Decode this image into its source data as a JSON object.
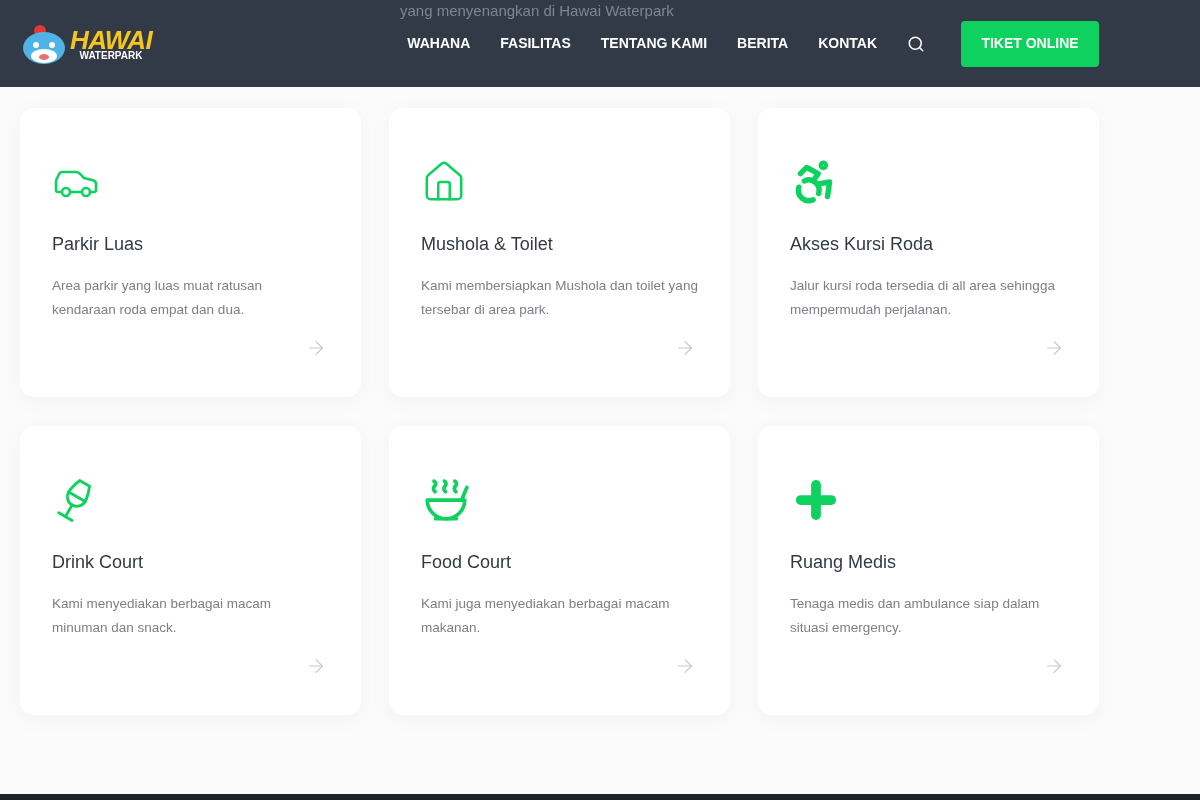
{
  "behind_header_text": "yang menyenangkan di Hawai Waterpark",
  "logo": {
    "title": "HAWAI",
    "subtitle": "WATERPARK"
  },
  "nav": [
    {
      "label": "WAHANA"
    },
    {
      "label": "FASILITAS"
    },
    {
      "label": "TENTANG KAMI"
    },
    {
      "label": "BERITA"
    },
    {
      "label": "KONTAK"
    }
  ],
  "cta": "TIKET ONLINE",
  "facilities": [
    {
      "kind": "car",
      "title": "Parkir Luas",
      "description": "Area parkir yang luas muat ratusan kendaraan roda empat dan dua."
    },
    {
      "kind": "house",
      "title": "Mushola & Toilet",
      "description": "Kami membersiapkan Mushola dan toilet yang tersebar di area park."
    },
    {
      "kind": "wheelchair",
      "title": "Akses Kursi Roda",
      "description": "Jalur kursi roda tersedia di all area sehingga mempermudah perjalanan."
    },
    {
      "kind": "glass",
      "title": "Drink Court",
      "description": "Kami menyediakan berbagai macam minuman dan snack."
    },
    {
      "kind": "bowl",
      "title": "Food Court",
      "description": "Kami juga menyediakan berbagai macam makanan."
    },
    {
      "kind": "cross",
      "title": "Ruang Medis",
      "description": "Tenaga medis dan ambulance siap dalam situasi emergency."
    }
  ]
}
